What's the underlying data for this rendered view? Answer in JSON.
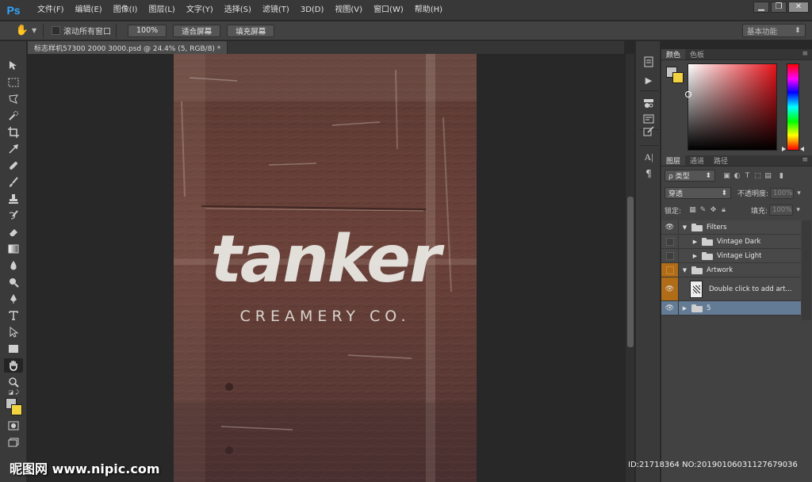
{
  "app": {
    "logo": "Ps",
    "menu": [
      "文件(F)",
      "编辑(E)",
      "图像(I)",
      "图层(L)",
      "文字(Y)",
      "选择(S)",
      "滤镜(T)",
      "3D(D)",
      "视图(V)",
      "窗口(W)",
      "帮助(H)"
    ],
    "window_controls": [
      "▁",
      "❐",
      "✕"
    ]
  },
  "options_bar": {
    "scroll_all_windows": "滚动所有窗口",
    "zoom_btn": "100%",
    "fit_screen_btn": "适合屏幕",
    "fill_screen_btn": "填充屏幕",
    "workspace": "基本功能"
  },
  "document": {
    "tab_title": "标志样机57300 2000 3000.psd @ 24.4% (5, RGB/8) *",
    "close": "×"
  },
  "artwork": {
    "wordmark": "tanker",
    "subline": "CREAMERY CO."
  },
  "panels": {
    "color_tabs": [
      "颜色",
      "色板"
    ],
    "layers_tabs": [
      "图层",
      "通道",
      "路径"
    ],
    "filter_kind": "ρ 类型",
    "blend_mode": "穿透",
    "opacity_label": "不透明度:",
    "opacity_value": "100%",
    "lock_label": "锁定:",
    "fill_label": "填充:",
    "fill_value": "100%",
    "layers": [
      {
        "name": "Filters",
        "visible": true,
        "type": "group",
        "expanded": true
      },
      {
        "name": "Vintage Dark",
        "visible": false,
        "type": "group",
        "expanded": false
      },
      {
        "name": "Vintage Light",
        "visible": false,
        "type": "group",
        "expanded": false
      },
      {
        "name": "Artwork",
        "visible": false,
        "type": "group",
        "expanded": true
      },
      {
        "name": "Double click to add art...",
        "visible": true,
        "type": "smart-object"
      },
      {
        "name": "5",
        "visible": true,
        "type": "group",
        "expanded": false
      }
    ]
  },
  "watermark": {
    "left": "昵图网 www.nipic.com",
    "right": "ID:21718364 NO:20190106031127679036"
  },
  "colors": {
    "accent_blue": "#31a8ff",
    "foreground": "#c4c4c4",
    "background": "#f2d23e",
    "selected_layer": "#647b95",
    "orange_highlight": "#b06c17"
  }
}
